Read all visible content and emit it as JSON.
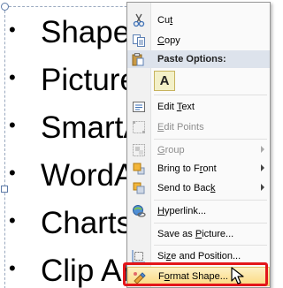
{
  "slide": {
    "bullets": [
      "Shapes",
      "Pictures",
      "SmartArt",
      "WordArt",
      "Charts",
      "Clip Art"
    ],
    "bullet_glyph": "•"
  },
  "context_menu": {
    "items": [
      {
        "key": "cut",
        "label_pre": "Cu",
        "underline": "t",
        "label_post": "",
        "icon": "scissors-icon",
        "enabled": true,
        "submenu": false
      },
      {
        "key": "copy",
        "label_pre": "",
        "underline": "C",
        "label_post": "opy",
        "icon": "copy-icon",
        "enabled": true,
        "submenu": false
      },
      {
        "key": "paste-options",
        "label": "Paste Options:",
        "icon": "paste-icon",
        "type": "header"
      },
      {
        "key": "paste-keep-text",
        "label": "A",
        "icon": "text-only-paste-icon",
        "type": "paste-button"
      },
      {
        "key": "edit-text",
        "label_pre": "Edit ",
        "underline": "T",
        "label_post": "ext",
        "icon": "edit-text-icon",
        "enabled": true,
        "submenu": false
      },
      {
        "key": "edit-points",
        "label_pre": "",
        "underline": "E",
        "label_post": "dit Points",
        "icon": "edit-points-icon",
        "enabled": false,
        "submenu": false
      },
      {
        "key": "group",
        "label_pre": "",
        "underline": "G",
        "label_post": "roup",
        "icon": "group-icon",
        "enabled": false,
        "submenu": true
      },
      {
        "key": "bring-to-front",
        "label_pre": "Bring to F",
        "underline": "r",
        "label_post": "ont",
        "icon": "bring-to-front-icon",
        "enabled": true,
        "submenu": true
      },
      {
        "key": "send-to-back",
        "label_pre": "Send to Bac",
        "underline": "k",
        "label_post": "",
        "icon": "send-to-back-icon",
        "enabled": true,
        "submenu": true
      },
      {
        "key": "hyperlink",
        "label_pre": "",
        "underline": "H",
        "label_post": "yperlink...",
        "icon": "hyperlink-icon",
        "enabled": true,
        "submenu": false
      },
      {
        "key": "save-as-picture",
        "label_pre": "Save as ",
        "underline": "P",
        "label_post": "icture...",
        "icon": "",
        "enabled": true,
        "submenu": false
      },
      {
        "key": "size-and-position",
        "label_pre": "Si",
        "underline": "z",
        "label_post": "e and Position...",
        "icon": "size-position-icon",
        "enabled": true,
        "submenu": false
      },
      {
        "key": "format-shape",
        "label_pre": "F",
        "underline": "o",
        "label_post": "rmat Shape...",
        "icon": "format-shape-icon",
        "enabled": true,
        "submenu": false,
        "highlighted": true
      }
    ]
  },
  "colors": {
    "highlight_box": "#e3161a",
    "menu_background": "#fafafa",
    "selection_handle": "#5d7aa7"
  }
}
